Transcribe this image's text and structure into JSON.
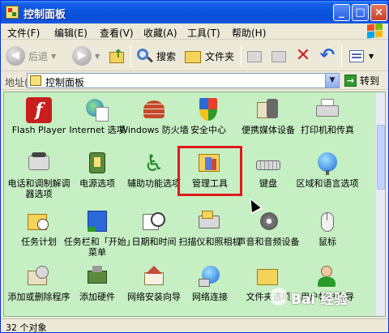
{
  "window": {
    "title": "控制面板"
  },
  "titlebar": {
    "min": "_",
    "max": "□",
    "close": "×"
  },
  "menu": [
    "文件(F)",
    "编辑(E)",
    "查看(V)",
    "收藏(A)",
    "工具(T)",
    "帮助(H)"
  ],
  "toolbar": {
    "back": "后退",
    "search": "搜索",
    "folders": "文件夹"
  },
  "address": {
    "label": "地址(D)",
    "value": "控制面板",
    "go": "转到"
  },
  "items": [
    {
      "label": "Flash Player",
      "icon": "flash-icon"
    },
    {
      "label": "Internet 选项",
      "icon": "internet-options-icon"
    },
    {
      "label": "Windows 防火墙",
      "icon": "firewall-icon"
    },
    {
      "label": "安全中心",
      "icon": "security-shield-icon"
    },
    {
      "label": "便携媒体设备",
      "icon": "media-device-icon"
    },
    {
      "label": "打印机和传真",
      "icon": "printer-icon"
    },
    {
      "label": "电话和调制解调器选项",
      "icon": "phone-modem-icon"
    },
    {
      "label": "电源选项",
      "icon": "power-icon"
    },
    {
      "label": "辅助功能选项",
      "icon": "accessibility-icon"
    },
    {
      "label": "管理工具",
      "icon": "admin-tools-icon"
    },
    {
      "label": "键盘",
      "icon": "keyboard-icon"
    },
    {
      "label": "区域和语言选项",
      "icon": "globe-icon"
    },
    {
      "label": "任务计划",
      "icon": "scheduled-tasks-icon"
    },
    {
      "label": "任务栏和「开始」菜单",
      "icon": "taskbar-icon"
    },
    {
      "label": "日期和时间",
      "icon": "clock-icon"
    },
    {
      "label": "扫描仪和照相机",
      "icon": "scanner-icon"
    },
    {
      "label": "声音和音频设备",
      "icon": "speaker-icon"
    },
    {
      "label": "鼠标",
      "icon": "mouse-icon"
    },
    {
      "label": "添加或删除程序",
      "icon": "add-remove-icon"
    },
    {
      "label": "添加硬件",
      "icon": "add-hardware-icon"
    },
    {
      "label": "网络安装向导",
      "icon": "network-setup-icon"
    },
    {
      "label": "网络连接",
      "icon": "network-connections-icon"
    },
    {
      "label": "文件夹选项",
      "icon": "folder-options-icon"
    },
    {
      "label": "用户帐户向导",
      "icon": "users-icon"
    }
  ],
  "status": {
    "text": "32 个对象"
  },
  "watermark": {
    "text": "Bai 经验"
  }
}
